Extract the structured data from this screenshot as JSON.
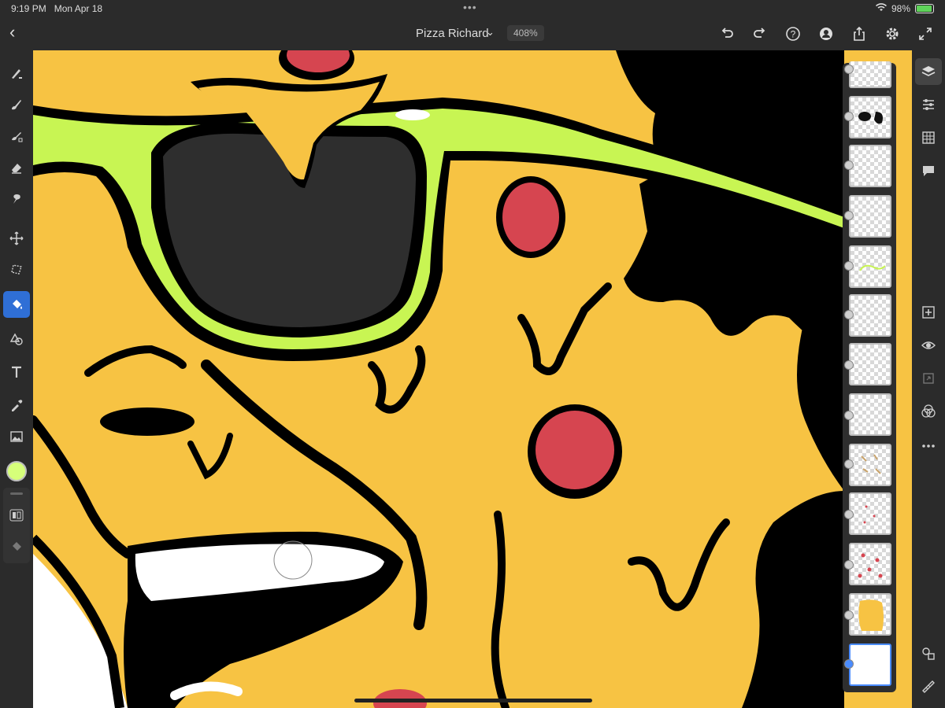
{
  "status": {
    "time": "9:19 PM",
    "date": "Mon Apr 18",
    "battery": "98%"
  },
  "document": {
    "title": "Pizza Richard",
    "zoom": "408%"
  },
  "icons": {
    "back": "chevron-left-icon",
    "title_menu": "chevron-down-icon",
    "top_actions": [
      "undo-icon",
      "redo-icon",
      "help-icon",
      "account-icon",
      "share-icon",
      "settings-icon",
      "fullscreen-icon"
    ],
    "left_tools": [
      "pixel-brush-icon",
      "live-brush-icon",
      "vector-brush-icon",
      "eraser-icon",
      "smudge-icon",
      "transform-icon",
      "lasso-select-icon",
      "fill-icon",
      "shapes-icon",
      "text-icon",
      "eyedropper-icon",
      "image-import-icon"
    ],
    "right_tools": [
      "layers-icon",
      "layer-properties-icon",
      "grid-icon",
      "comments-icon",
      "add-layer-icon",
      "visibility-eye-icon",
      "mask-icon",
      "blend-mode-icon",
      "more-icon",
      "shapes-library-icon",
      "ruler-icon"
    ]
  },
  "colors": {
    "current_color": "#d6ff7a",
    "accent": "#2f6fd6",
    "pizza": "#f7c343",
    "glasses": "#c8f553",
    "pepperoni": "#d64550"
  },
  "layers": {
    "count": 13,
    "selected_index": 12
  }
}
